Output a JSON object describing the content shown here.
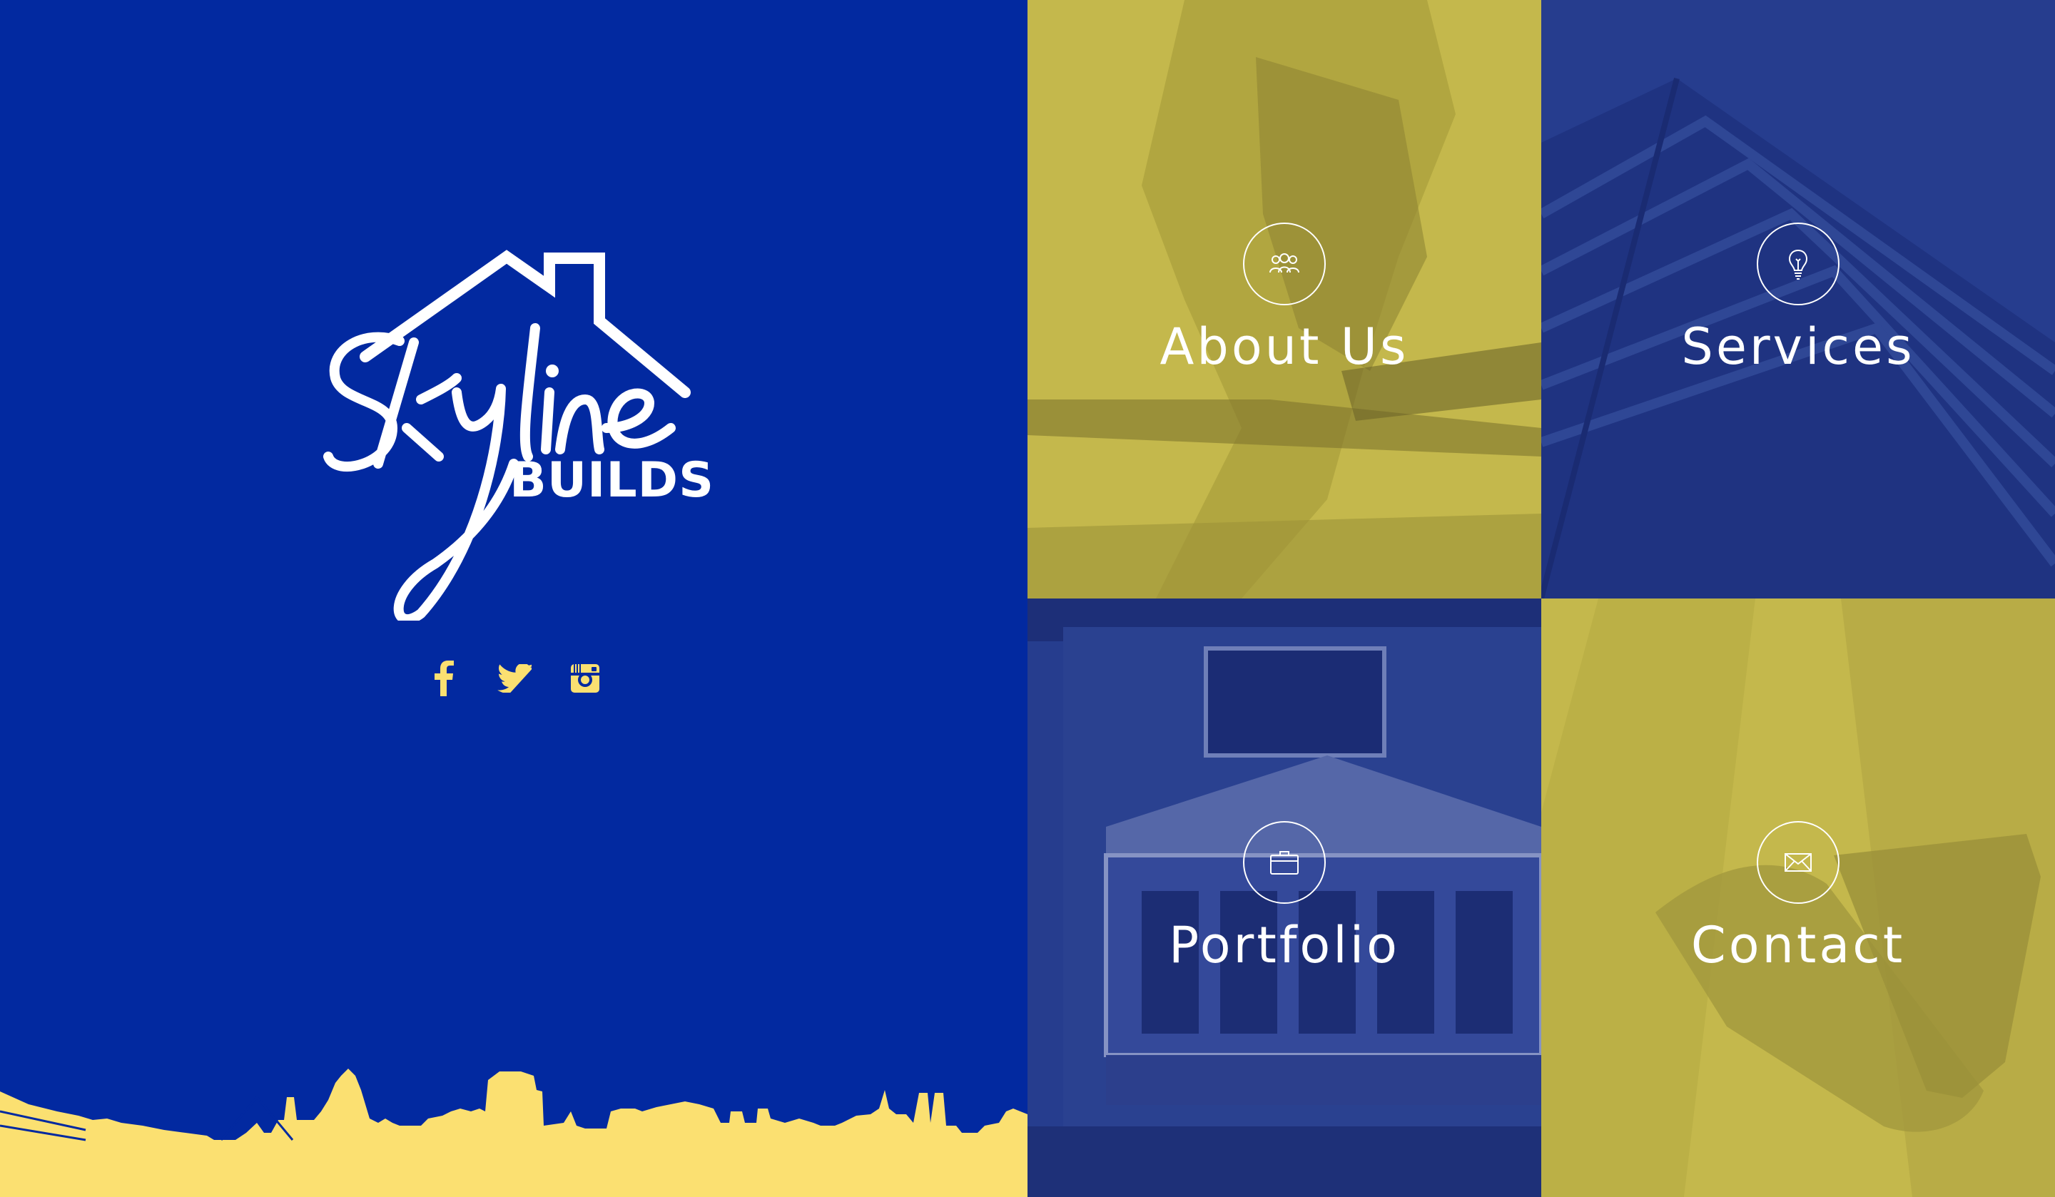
{
  "brand": {
    "script_word": "Skyline",
    "builds_word": "BUILDS"
  },
  "social": {
    "facebook_icon": "facebook-icon",
    "twitter_icon": "twitter-icon",
    "instagram_icon": "instagram-icon"
  },
  "tiles": [
    {
      "label": "About Us",
      "icon": "people-icon"
    },
    {
      "label": "Services",
      "icon": "lightbulb-icon"
    },
    {
      "label": "Portfolio",
      "icon": "briefcase-icon"
    },
    {
      "label": "Contact",
      "icon": "envelope-icon"
    }
  ],
  "colors": {
    "left_panel_blue": "#0229a0",
    "skyline_yellow": "#fbe071",
    "overlay_yellow": "#c4b84c",
    "overlay_blue": "#263d8e",
    "icon_white": "#ffffff"
  }
}
